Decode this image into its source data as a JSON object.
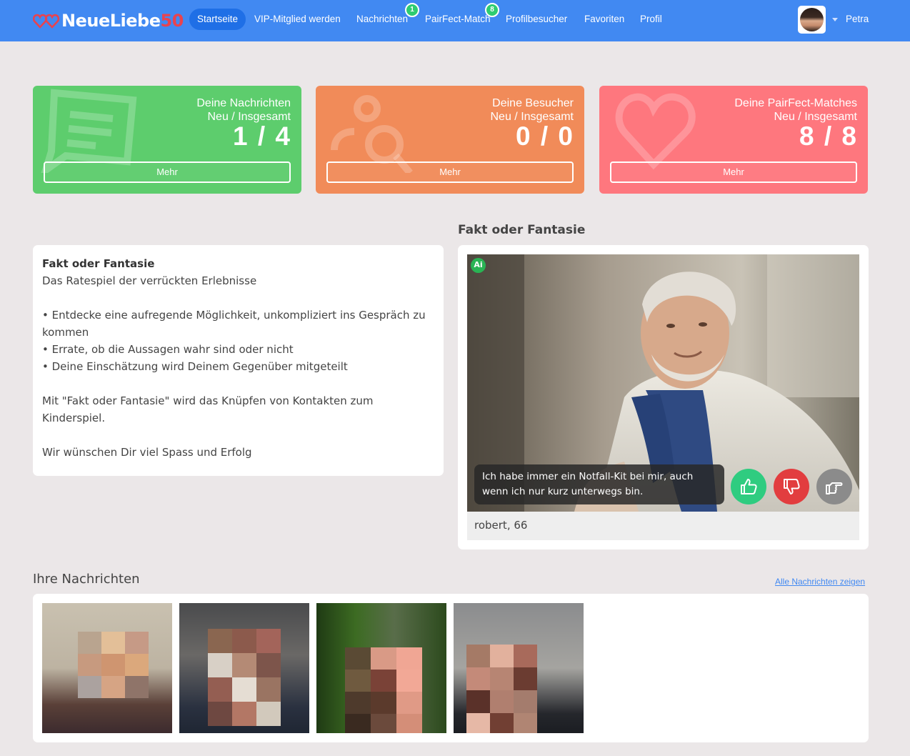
{
  "nav": {
    "logo_text": "NeueLiebe",
    "logo_number": "50",
    "items": [
      {
        "label": "Startseite",
        "active": true
      },
      {
        "label": "VIP-Mitglied werden"
      },
      {
        "label": "Nachrichten",
        "badge": "1"
      },
      {
        "label": "PairFect-Match",
        "badge": "8"
      },
      {
        "label": "Profilbesucher"
      },
      {
        "label": "Favoriten"
      },
      {
        "label": "Profil"
      }
    ],
    "user_name": "Petra",
    "icons": {
      "logo": "hearts-icon",
      "caret": "caret-down-icon"
    }
  },
  "cards": [
    {
      "title1": "Deine Nachrichten",
      "title2": "Neu / Insgesamt",
      "value": "1 / 4",
      "button": "Mehr",
      "color": "#5dcd6d",
      "icon": "message-icon"
    },
    {
      "title1": "Deine Besucher",
      "title2": "Neu / Insgesamt",
      "value": "0 / 0",
      "button": "Mehr",
      "color": "#f18b59",
      "icon": "visitors-icon"
    },
    {
      "title1": "Deine PairFect-Matches",
      "title2": "Neu / Insgesamt",
      "value": "8 / 8",
      "button": "Mehr",
      "color": "#fe777e",
      "icon": "heart-icon"
    }
  ],
  "info": {
    "title": "Fakt oder Fantasie",
    "subtitle": "Das Ratespiel der verrückten Erlebnisse",
    "bullet1": "• Entdecke eine aufregende Möglichkeit, unkompliziert ins Gespräch zu kommen",
    "bullet2": "• Errate, ob die Aussagen wahr sind oder nicht",
    "bullet3": "• Deine Einschätzung wird Deinem Gegenüber mitgeteilt",
    "para": "Mit \"Fakt oder Fantasie\" wird das Knüpfen von Kontakten zum Kinderspiel.",
    "closing": "Wir wünschen Dir viel Spass und Erfolg"
  },
  "fakt": {
    "heading": "Fakt oder Fantasie",
    "ai_badge": "Ai",
    "statement": "Ich habe immer ein Notfall-Kit bei mir, auch wenn ich nur kurz unterwegs bin.",
    "caption": "robert, 66",
    "buttons": [
      {
        "icon": "thumbs-up-icon",
        "color": "#2fcc80"
      },
      {
        "icon": "thumbs-down-icon",
        "color": "#e23d3f"
      },
      {
        "icon": "point-right-icon",
        "color": "#8b8b8b"
      }
    ]
  },
  "messages": {
    "heading": "Ihre Nachrichten",
    "link": "Alle Nachrichten zeigen"
  }
}
